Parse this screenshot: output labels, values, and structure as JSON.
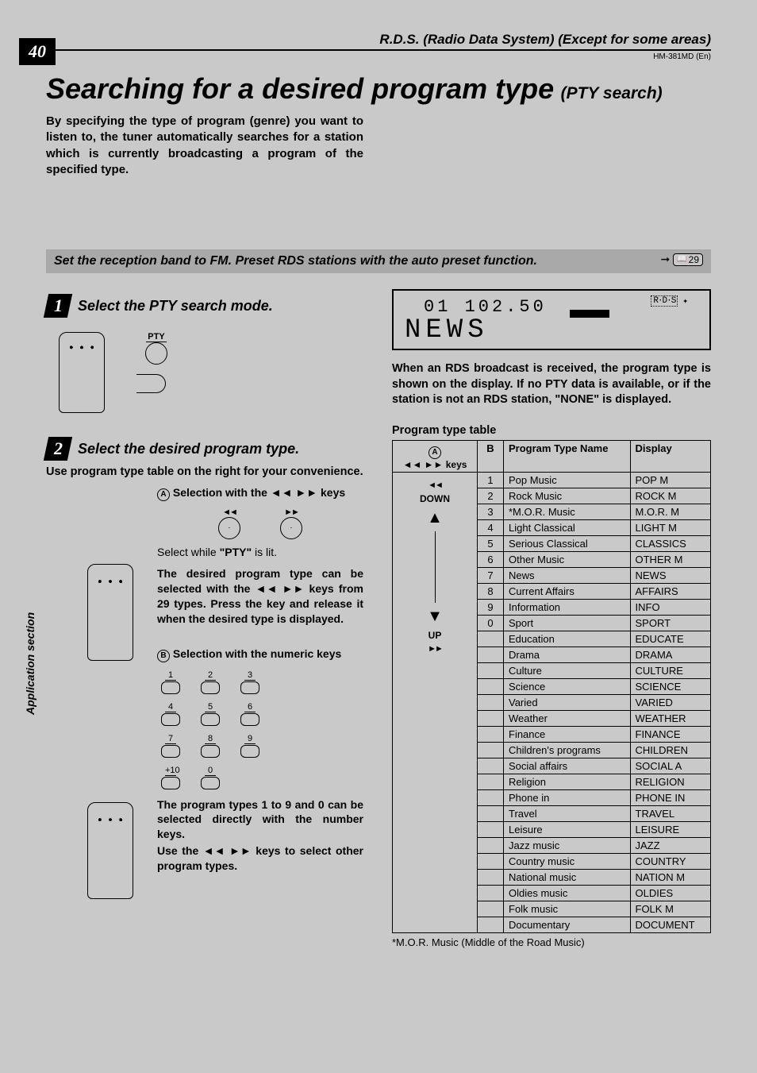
{
  "page_number": "40",
  "vertical_label": "Application section",
  "header_right": "R.D.S. (Radio Data System) (Except for some areas)",
  "doc_id": "HM-381MD (En)",
  "title_main": "Searching for a desired program type",
  "title_sub": "(PTY search)",
  "intro": "By specifying the type of program (genre) you want to listen to, the tuner automatically searches for a station which is currently broadcasting a program of the specified type.",
  "grey_bar": "Set the reception band to FM.  Preset RDS stations with the auto preset function.",
  "ref_num": "29",
  "step1_title": "Select the PTY search mode.",
  "pty_label": "PTY",
  "step2_title": "Select the desired program type.",
  "step2_body": "Use program type table on the right for your convenience.",
  "selA_label": "Selection with the ◄◄ ►► keys",
  "selA_note": "Select while \"PTY\" is lit.",
  "selA_bold": "The desired program type can be selected with the ◄◄ ►► keys from 29 types. Press the key and release it when the desired type is displayed.",
  "selB_label": "Selection with the numeric keys",
  "selB_bold1": "The program types 1 to 9 and 0 can be selected directly with the number keys.",
  "selB_bold2": "Use the ◄◄ ►► keys to select other program types.",
  "display_digits": "01  102.50",
  "display_text": "NEWS",
  "right_para": "When an RDS broadcast is received, the program type is shown on the display. If no PTY data is available, or if the station is not an RDS station, \"NONE\" is displayed.",
  "table_caption": "Program type table",
  "colA_header_keys": "◄◄ ►► keys",
  "colB_name": "Program Type Name",
  "colC_name": "Display",
  "colA_down": "DOWN",
  "colA_up": "UP",
  "footnote": "*M.O.R. Music (Middle of the Road Music)",
  "rows": [
    {
      "b": "1",
      "name": "Pop Music",
      "disp": "POP M"
    },
    {
      "b": "2",
      "name": "Rock Music",
      "disp": "ROCK M"
    },
    {
      "b": "3",
      "name": "*M.O.R. Music",
      "disp": "M.O.R. M"
    },
    {
      "b": "4",
      "name": "Light Classical",
      "disp": "LIGHT M"
    },
    {
      "b": "5",
      "name": "Serious Classical",
      "disp": "CLASSICS"
    },
    {
      "b": "6",
      "name": "Other Music",
      "disp": "OTHER M"
    },
    {
      "b": "7",
      "name": "News",
      "disp": "NEWS"
    },
    {
      "b": "8",
      "name": "Current Affairs",
      "disp": "AFFAIRS"
    },
    {
      "b": "9",
      "name": "Information",
      "disp": "INFO"
    },
    {
      "b": "0",
      "name": "Sport",
      "disp": "SPORT"
    },
    {
      "b": "",
      "name": "Education",
      "disp": "EDUCATE"
    },
    {
      "b": "",
      "name": "Drama",
      "disp": "DRAMA"
    },
    {
      "b": "",
      "name": "Culture",
      "disp": "CULTURE"
    },
    {
      "b": "",
      "name": "Science",
      "disp": "SCIENCE"
    },
    {
      "b": "",
      "name": "Varied",
      "disp": "VARIED"
    },
    {
      "b": "",
      "name": "Weather",
      "disp": "WEATHER"
    },
    {
      "b": "",
      "name": "Finance",
      "disp": "FINANCE"
    },
    {
      "b": "",
      "name": "Children's programs",
      "disp": "CHILDREN"
    },
    {
      "b": "",
      "name": "Social affairs",
      "disp": "SOCIAL A"
    },
    {
      "b": "",
      "name": "Religion",
      "disp": "RELIGION"
    },
    {
      "b": "",
      "name": "Phone in",
      "disp": "PHONE IN"
    },
    {
      "b": "",
      "name": "Travel",
      "disp": "TRAVEL"
    },
    {
      "b": "",
      "name": "Leisure",
      "disp": "LEISURE"
    },
    {
      "b": "",
      "name": "Jazz music",
      "disp": "JAZZ"
    },
    {
      "b": "",
      "name": "Country music",
      "disp": "COUNTRY"
    },
    {
      "b": "",
      "name": "National music",
      "disp": "NATION M"
    },
    {
      "b": "",
      "name": "Oldies music",
      "disp": "OLDIES"
    },
    {
      "b": "",
      "name": "Folk music",
      "disp": "FOLK M"
    },
    {
      "b": "",
      "name": "Documentary",
      "disp": "DOCUMENT"
    }
  ],
  "keypad": [
    "1",
    "2",
    "3",
    "4",
    "5",
    "6",
    "7",
    "8",
    "9",
    "+10",
    "0"
  ]
}
